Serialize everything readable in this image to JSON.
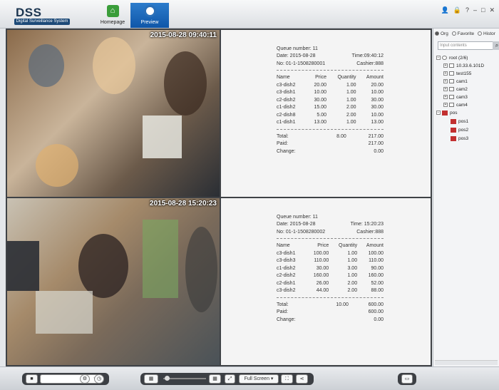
{
  "app": {
    "logo": "DSS",
    "logo_subtitle": "Digital Surveillance System"
  },
  "nav": {
    "homepage": "Homepage",
    "preview": "Preview"
  },
  "windows": [
    {
      "timestamp": "2015-08-28 09:40:11"
    },
    {
      "timestamp": "2015-08-28 15:20:23"
    }
  ],
  "receipts": [
    {
      "queue": "Queue number: 11",
      "date": "Date: 2015-08-28",
      "time": "Time:09:40:12",
      "no": "No: 01-1-1508280001",
      "cashier": "Cashier:888",
      "headers": [
        "Name",
        "Price",
        "Quantity",
        "Amount"
      ],
      "rows": [
        [
          "c3-dish2",
          "20.00",
          "1.00",
          "20.00"
        ],
        [
          "c3-dish1",
          "10.00",
          "1.00",
          "10.00"
        ],
        [
          "c2-dish2",
          "30.00",
          "1.00",
          "30.00"
        ],
        [
          "c1-dish2",
          "15.00",
          "2.00",
          "30.00"
        ],
        [
          "c2-dish8",
          "5.00",
          "2.00",
          "10.00"
        ],
        [
          "c1-dish1",
          "13.00",
          "1.00",
          "13.00"
        ]
      ],
      "total_label": "Total:",
      "total_qty": "8.00",
      "total_amount": "217.00",
      "paid_label": "Paid:",
      "paid": "217.00",
      "change_label": "Change:",
      "change": "0.00"
    },
    {
      "queue": "Queue number: 11",
      "date": "Date: 2015-08-28",
      "time": "Time: 15:20:23",
      "no": "No: 01-1-1508280002",
      "cashier": "Cashier:888",
      "headers": [
        "Name",
        "Price",
        "Quantity",
        "Amount"
      ],
      "rows": [
        [
          "c3-dish1",
          "100.00",
          "1.00",
          "100.00"
        ],
        [
          "c3-dish3",
          "110.00",
          "1.00",
          "110.00"
        ],
        [
          "c1-dish2",
          "30.00",
          "3.00",
          "90.00"
        ],
        [
          "c2-dish2",
          "160.00",
          "1.00",
          "160.00"
        ],
        [
          "c2-dish1",
          "26.00",
          "2.00",
          "52.00"
        ],
        [
          "c3-dish2",
          "44.00",
          "2.00",
          "88.00"
        ]
      ],
      "total_label": "Total:",
      "total_qty": "10.00",
      "total_amount": "600.00",
      "paid_label": "Paid:",
      "paid": "600.00",
      "change_label": "Change:",
      "change": "0.00"
    }
  ],
  "sidebar": {
    "radios": [
      {
        "label": "Org",
        "selected": true
      },
      {
        "label": "Favorite",
        "selected": false
      },
      {
        "label": "Histor",
        "selected": false
      }
    ],
    "search_placeholder": "Input contents",
    "tree": {
      "root": "root (2/6)",
      "device": "10.33.6.101D",
      "devices": [
        "test155",
        "cam1",
        "cam2",
        "cam3",
        "cam4"
      ],
      "pos_group": "pos",
      "pos_items": [
        "pos1",
        "pos2",
        "pos3"
      ]
    }
  },
  "toolbar": {
    "full_screen": "Full Screen"
  },
  "colors": {
    "accent": "#1565b8",
    "bg": "#e4e7ea",
    "pos_icon": "#c23030"
  }
}
